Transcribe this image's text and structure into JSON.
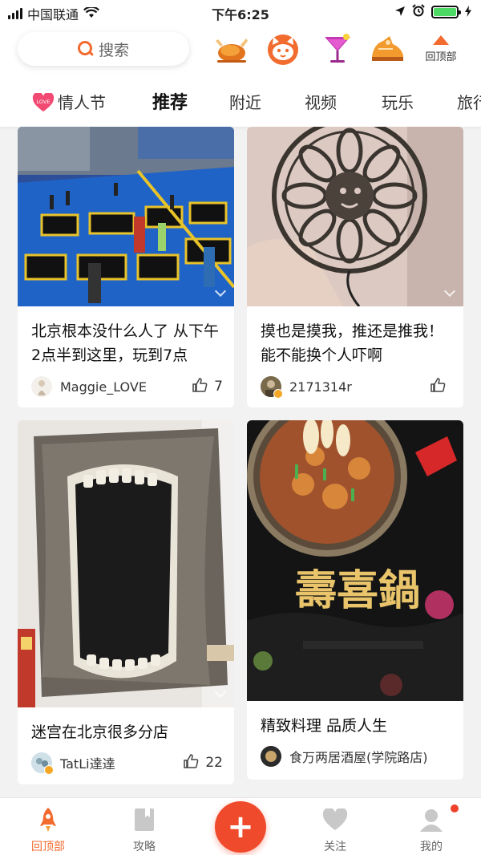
{
  "status_bar": {
    "carrier": "中国联通",
    "time": "下午6:25"
  },
  "header": {
    "search_label": "搜索",
    "back_to_top_label": "回顶部",
    "icons": [
      "roast-chicken-icon",
      "cat-face-icon",
      "cocktail-icon",
      "shoe-icon"
    ]
  },
  "tabs": {
    "items": [
      "情人节",
      "推荐",
      "附近",
      "视频",
      "玩乐",
      "旅行"
    ],
    "active": "推荐",
    "love_badge": "LOVE"
  },
  "feed": {
    "cards": [
      {
        "title": "北京根本没什么人了 从下午2点半到这里，玩到7点",
        "username": "Maggie_LOVE",
        "likes": "7",
        "image": "trampoline-park-photo"
      },
      {
        "title": "摸也是摸我，推还是推我！能不能换个人吓啊",
        "username": "2171314r",
        "likes": "",
        "image": "sunflower-metal-medallion-photo"
      },
      {
        "title": "迷宫在北京很多分店",
        "username": "TatLi達達",
        "likes": "22",
        "image": "giant-mouth-entrance-photo"
      },
      {
        "title": "精致料理 品质人生",
        "username": "食万两居酒屋(学院路店)",
        "likes": "",
        "image": "hotpot-poster",
        "poster_text": "壽喜鍋"
      }
    ]
  },
  "bottom_nav": {
    "items": [
      "回顶部",
      "攻略",
      "关注",
      "我的"
    ],
    "active": "回顶部"
  },
  "colors": {
    "accent": "#f26b2f",
    "plus_button": "#f04a2c",
    "battery": "#4cd964"
  }
}
